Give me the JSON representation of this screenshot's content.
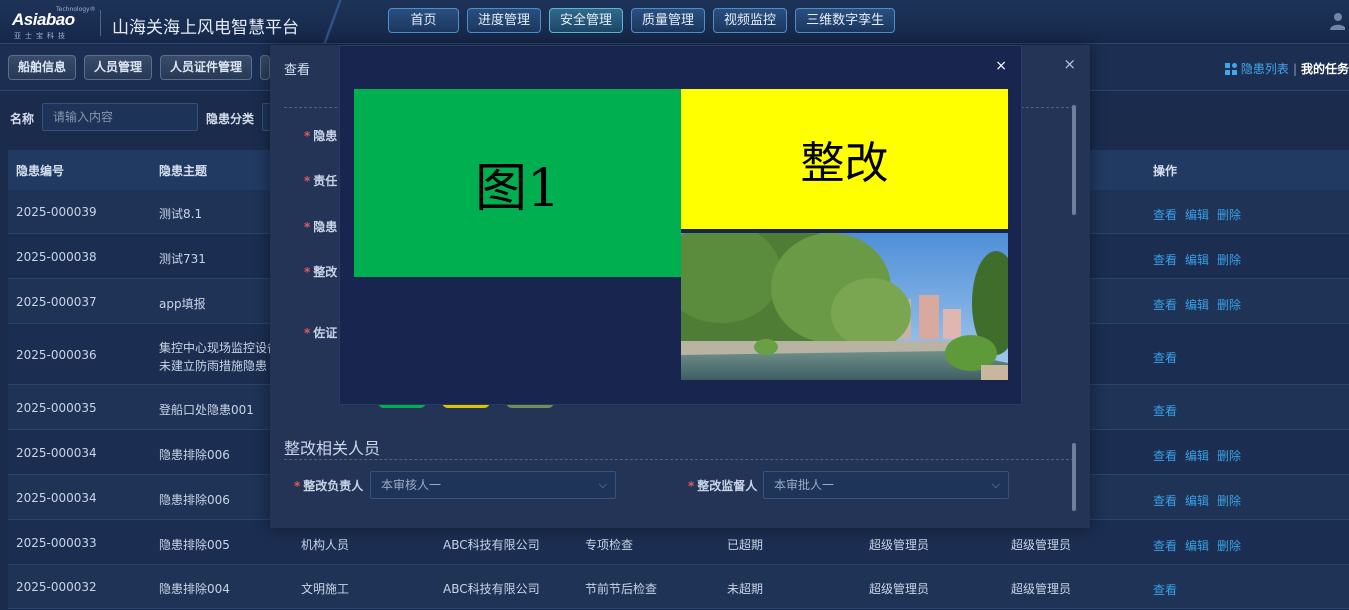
{
  "header": {
    "logo_text": "Asiabao",
    "logo_tech": "Technology®",
    "logo_sub": "亚士宝科技",
    "title": "山海关海上风电智慧平台",
    "nav": [
      {
        "label": "首页"
      },
      {
        "label": "进度管理"
      },
      {
        "label": "安全管理"
      },
      {
        "label": "质量管理"
      },
      {
        "label": "视频监控"
      },
      {
        "label": "三维数字孪生"
      }
    ],
    "active_nav": "安全管理",
    "user_icon": "user-icon"
  },
  "subtabs": [
    {
      "label": "船舶信息"
    },
    {
      "label": "人员管理"
    },
    {
      "label": "人员证件管理"
    }
  ],
  "subright": {
    "list_label": "隐患列表",
    "separator": "|",
    "mytask_label": "我的任务"
  },
  "filter": {
    "name_label": "名称",
    "name_placeholder": "请输入内容",
    "category_label": "隐患分类"
  },
  "table": {
    "headers": {
      "id": "隐患编号",
      "subject": "隐患主题",
      "ops": "操作"
    },
    "ops_labels": {
      "view": "查看",
      "edit": "编辑",
      "delete": "删除"
    },
    "rows": [
      {
        "id": "2025-000039",
        "subject": "测试8.1",
        "subject2": "",
        "c3": "",
        "c4": "",
        "c5": "",
        "c6": "",
        "c7": "",
        "c8": "",
        "full_ops": true
      },
      {
        "id": "2025-000038",
        "subject": "测试731",
        "subject2": "",
        "c3": "",
        "c4": "",
        "c5": "",
        "c6": "",
        "c7": "",
        "c8": "",
        "full_ops": true
      },
      {
        "id": "2025-000037",
        "subject": "app填报",
        "subject2": "",
        "c3": "",
        "c4": "",
        "c5": "",
        "c6": "",
        "c7": "",
        "c8": "",
        "full_ops": true
      },
      {
        "id": "2025-000036",
        "subject": "集控中心现场监控设备",
        "subject2": "未建立防雨措施隐患",
        "c3": "",
        "c4": "",
        "c5": "",
        "c6": "",
        "c7": "",
        "c8": "",
        "full_ops": false
      },
      {
        "id": "2025-000035",
        "subject": "登船口处隐患001",
        "subject2": "",
        "c3": "",
        "c4": "",
        "c5": "",
        "c6": "",
        "c7": "",
        "c8": "",
        "full_ops": false
      },
      {
        "id": "2025-000034",
        "subject": "隐患排除006",
        "subject2": "",
        "c3": "",
        "c4": "",
        "c5": "",
        "c6": "",
        "c7": "",
        "c8": "",
        "full_ops": true
      },
      {
        "id": "2025-000034",
        "subject": "隐患排除006",
        "subject2": "",
        "c3": "",
        "c4": "",
        "c5": "",
        "c6": "",
        "c7": "",
        "c8": "",
        "full_ops": true
      },
      {
        "id": "2025-000033",
        "subject": "隐患排除005",
        "subject2": "",
        "c3": "机构人员",
        "c4": "ABC科技有限公司",
        "c5": "专项检查",
        "c6": "已超期",
        "c7": "超级管理员",
        "c8": "超级管理员",
        "full_ops": true
      },
      {
        "id": "2025-000032",
        "subject": "隐患排除004",
        "subject2": "",
        "c3": "文明施工",
        "c4": "ABC科技有限公司",
        "c5": "节前节后检查",
        "c6": "未超期",
        "c7": "超级管理员",
        "c8": "超级管理员",
        "full_ops": false
      }
    ]
  },
  "modal": {
    "title": "查看",
    "close": "×",
    "field_labels": [
      "隐患",
      "责任",
      "隐患",
      "整改",
      "佐证"
    ],
    "section_title": "整改相关人员",
    "owner_label": "整改负责人",
    "owner_value": "本审核人一",
    "supervisor_label": "整改监督人",
    "supervisor_value": "本审批人一"
  },
  "viewer": {
    "close": "×",
    "img1_text": "图1",
    "img2_text": "整改",
    "img1_color": "#00b050",
    "img2_color": "#ffff00"
  }
}
